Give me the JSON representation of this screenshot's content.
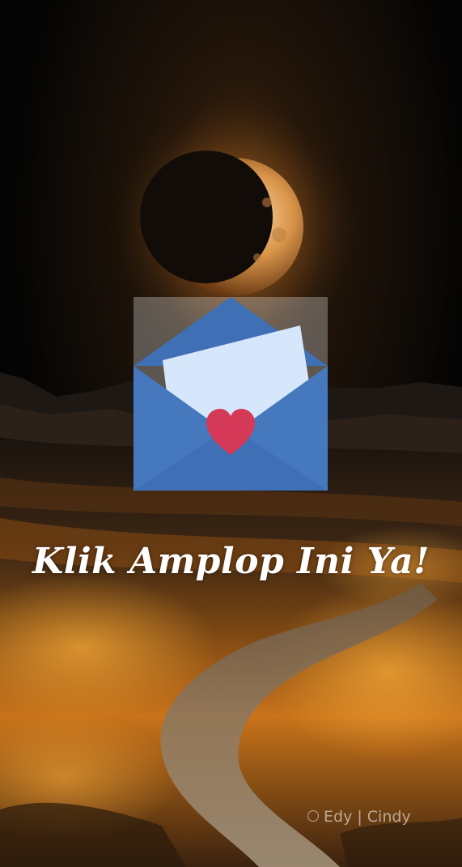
{
  "screen": {
    "cta_text": "Klik Amplop Ini Ya!",
    "watermark": "Edy | Cindy"
  },
  "envelope": {
    "icon": "envelope-with-heart-icon",
    "colors": {
      "body": "#4f7fc1",
      "flap": "#3f6fb4",
      "letter": "#d6e6fb",
      "heart": "#d43a58"
    }
  },
  "scene": {
    "icons": [
      "crescent-moon",
      "mountains",
      "grass-field",
      "winding-path"
    ],
    "colors": {
      "sky": "#040404",
      "moon_glow": "#f2a64a",
      "field": "#e38a1e"
    }
  }
}
